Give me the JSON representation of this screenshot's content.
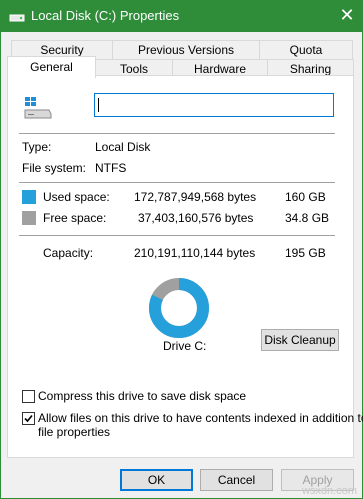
{
  "window": {
    "title": "Local Disk (C:) Properties",
    "close_glyph": "✕",
    "icon": "drive-icon"
  },
  "tabs_row1": [
    {
      "label": "Security"
    },
    {
      "label": "Previous Versions"
    },
    {
      "label": "Quota"
    }
  ],
  "tabs_row2": [
    {
      "label": "General",
      "active": true
    },
    {
      "label": "Tools"
    },
    {
      "label": "Hardware"
    },
    {
      "label": "Sharing"
    }
  ],
  "general": {
    "drive_icon": "windows-drive-icon",
    "name_value": "",
    "type_label": "Type:",
    "type_value": "Local Disk",
    "fs_label": "File system:",
    "fs_value": "NTFS",
    "used": {
      "label": "Used space:",
      "bytes": "172,787,949,568 bytes",
      "size": "160 GB",
      "color": "#26a0da"
    },
    "free": {
      "label": "Free space:",
      "bytes": "37,403,160,576 bytes",
      "size": "34.8 GB",
      "color": "#a0a0a0"
    },
    "capacity": {
      "label": "Capacity:",
      "bytes": "210,191,110,144 bytes",
      "size": "195 GB"
    },
    "used_fraction": 0.822,
    "ring_colors": {
      "used": "#26a0da",
      "free": "#a0a0a0"
    },
    "drive_label": "Drive C:",
    "cleanup_button": "Disk Cleanup",
    "compress": {
      "label": "Compress this drive to save disk space",
      "checked": false
    },
    "index": {
      "label": "Allow files on this drive to have contents indexed in addition to file properties",
      "line1": "Allow files on this drive to have contents indexed in addition to",
      "line2": "file properties",
      "checked": true
    }
  },
  "footer": {
    "ok": "OK",
    "cancel": "Cancel",
    "apply": "Apply"
  },
  "watermark": "wsxdn.com"
}
